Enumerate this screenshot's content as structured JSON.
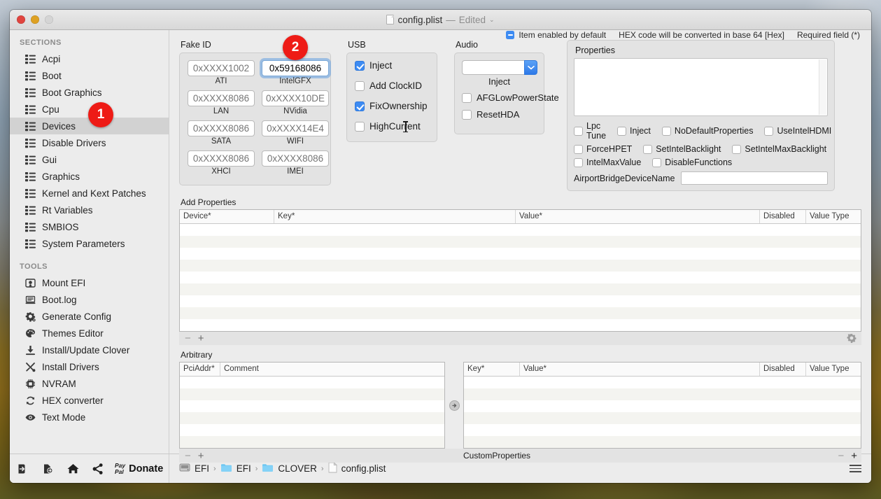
{
  "window": {
    "title": "config.plist",
    "title_separator": "—",
    "edited_label": "Edited",
    "chevron": "⌄"
  },
  "sidebar": {
    "sections_header": "SECTIONS",
    "sections": [
      {
        "label": "Acpi",
        "icon": "list-icon",
        "selected": false
      },
      {
        "label": "Boot",
        "icon": "list-icon",
        "selected": false
      },
      {
        "label": "Boot Graphics",
        "icon": "list-icon",
        "selected": false
      },
      {
        "label": "Cpu",
        "icon": "list-icon",
        "selected": false
      },
      {
        "label": "Devices",
        "icon": "list-icon",
        "selected": true
      },
      {
        "label": "Disable Drivers",
        "icon": "list-icon",
        "selected": false
      },
      {
        "label": "Gui",
        "icon": "list-icon",
        "selected": false
      },
      {
        "label": "Graphics",
        "icon": "list-icon",
        "selected": false
      },
      {
        "label": "Kernel and Kext Patches",
        "icon": "list-icon",
        "selected": false
      },
      {
        "label": "Rt Variables",
        "icon": "list-icon",
        "selected": false
      },
      {
        "label": "SMBIOS",
        "icon": "list-icon",
        "selected": false
      },
      {
        "label": "System Parameters",
        "icon": "list-icon",
        "selected": false
      }
    ],
    "tools_header": "TOOLS",
    "tools": [
      {
        "label": "Mount EFI",
        "icon": "mount-efi-icon"
      },
      {
        "label": "Boot.log",
        "icon": "log-icon"
      },
      {
        "label": "Generate Config",
        "icon": "gear-icon"
      },
      {
        "label": "Themes Editor",
        "icon": "palette-icon"
      },
      {
        "label": "Install/Update Clover",
        "icon": "download-icon"
      },
      {
        "label": "Install Drivers",
        "icon": "tools-icon"
      },
      {
        "label": "NVRAM",
        "icon": "chip-icon"
      },
      {
        "label": "HEX converter",
        "icon": "refresh-icon"
      },
      {
        "label": "Text Mode",
        "icon": "eye-icon"
      }
    ]
  },
  "badges": [
    {
      "number": "1"
    },
    {
      "number": "2"
    }
  ],
  "topnotes": {
    "item_enabled_by_default": "Item enabled by default",
    "hex_note": "HEX code will be converted in base 64 [Hex]",
    "required_field": "Required field (*)"
  },
  "fake_id": {
    "label": "Fake ID",
    "fields": [
      {
        "caption": "ATI",
        "value": "",
        "placeholder": "0xXXXX1002",
        "focused": false
      },
      {
        "caption": "IntelGFX",
        "value": "0x59168086",
        "placeholder": "0xXXXX8086",
        "focused": true
      },
      {
        "caption": "LAN",
        "value": "",
        "placeholder": "0xXXXX8086",
        "focused": false
      },
      {
        "caption": "NVidia",
        "value": "",
        "placeholder": "0xXXXX10DE",
        "focused": false
      },
      {
        "caption": "SATA",
        "value": "",
        "placeholder": "0xXXXX8086",
        "focused": false
      },
      {
        "caption": "WIFI",
        "value": "",
        "placeholder": "0xXXXX14E4",
        "focused": false
      },
      {
        "caption": "XHCI",
        "value": "",
        "placeholder": "0xXXXX8086",
        "focused": false
      },
      {
        "caption": "IMEI",
        "value": "",
        "placeholder": "0xXXXX8086",
        "focused": false
      }
    ]
  },
  "usb": {
    "label": "USB",
    "options": [
      {
        "label": "Inject",
        "checked": true
      },
      {
        "label": "Add ClockID",
        "checked": false
      },
      {
        "label": "FixOwnership",
        "checked": true
      },
      {
        "label": "HighCurrent",
        "checked": false
      }
    ]
  },
  "audio": {
    "label": "Audio",
    "select_value": "",
    "select_caption": "Inject",
    "options": [
      {
        "label": "AFGLowPowerState",
        "checked": false
      },
      {
        "label": "ResetHDA",
        "checked": false
      }
    ]
  },
  "properties": {
    "label": "Properties",
    "textarea_value": "",
    "checkboxes_row1": [
      {
        "label": "Lpc Tune",
        "checked": false
      },
      {
        "label": "Inject",
        "checked": false
      },
      {
        "label": "NoDefaultProperties",
        "checked": false
      },
      {
        "label": "UseIntelHDMI",
        "checked": false
      }
    ],
    "checkboxes_row2": [
      {
        "label": "ForceHPET",
        "checked": false
      },
      {
        "label": "SetIntelBacklight",
        "checked": false
      },
      {
        "label": "SetIntelMaxBacklight",
        "checked": false
      }
    ],
    "checkboxes_row3": [
      {
        "label": "IntelMaxValue",
        "checked": false
      },
      {
        "label": "DisableFunctions",
        "checked": false
      }
    ],
    "airport_label": "AirportBridgeDeviceName",
    "airport_value": ""
  },
  "add_properties": {
    "label": "Add Properties",
    "columns": [
      "Device*",
      "Key*",
      "Value*",
      "Disabled",
      "Value Type"
    ],
    "rows": [],
    "row_count": 9,
    "remove_label": "−",
    "add_label": "+",
    "gear_icon": "gear-icon"
  },
  "arbitrary": {
    "label": "Arbitrary",
    "left_columns": [
      "PciAddr*",
      "Comment"
    ],
    "left_rows": [],
    "left_row_count": 6,
    "right_columns": [
      "Key*",
      "Value*",
      "Disabled",
      "Value Type"
    ],
    "right_rows": [],
    "right_row_count": 6,
    "custom_properties_label": "CustomProperties",
    "remove_label": "−",
    "add_label": "+",
    "transfer_icon": "arrow-right-circle-icon"
  },
  "bottom_bar": {
    "buttons": [
      {
        "name": "import-icon"
      },
      {
        "name": "export-icon"
      },
      {
        "name": "home-icon"
      },
      {
        "name": "share-icon"
      }
    ],
    "paypal_line1": "Pay",
    "paypal_line2": "Pal",
    "donate_label": "Donate",
    "path": [
      {
        "label": "EFI",
        "icon": "disk-icon"
      },
      {
        "label": "EFI",
        "icon": "folder-icon"
      },
      {
        "label": "CLOVER",
        "icon": "folder-icon"
      },
      {
        "label": "config.plist",
        "icon": "file-icon"
      }
    ],
    "separator": "›",
    "menu_icon": "hamburger-icon"
  },
  "colors": {
    "accent_blue": "#3d8bf2",
    "badge_red": "#ee1b16",
    "selection_grey": "#d2d2d2",
    "folder_blue": "#6fc7f2"
  }
}
